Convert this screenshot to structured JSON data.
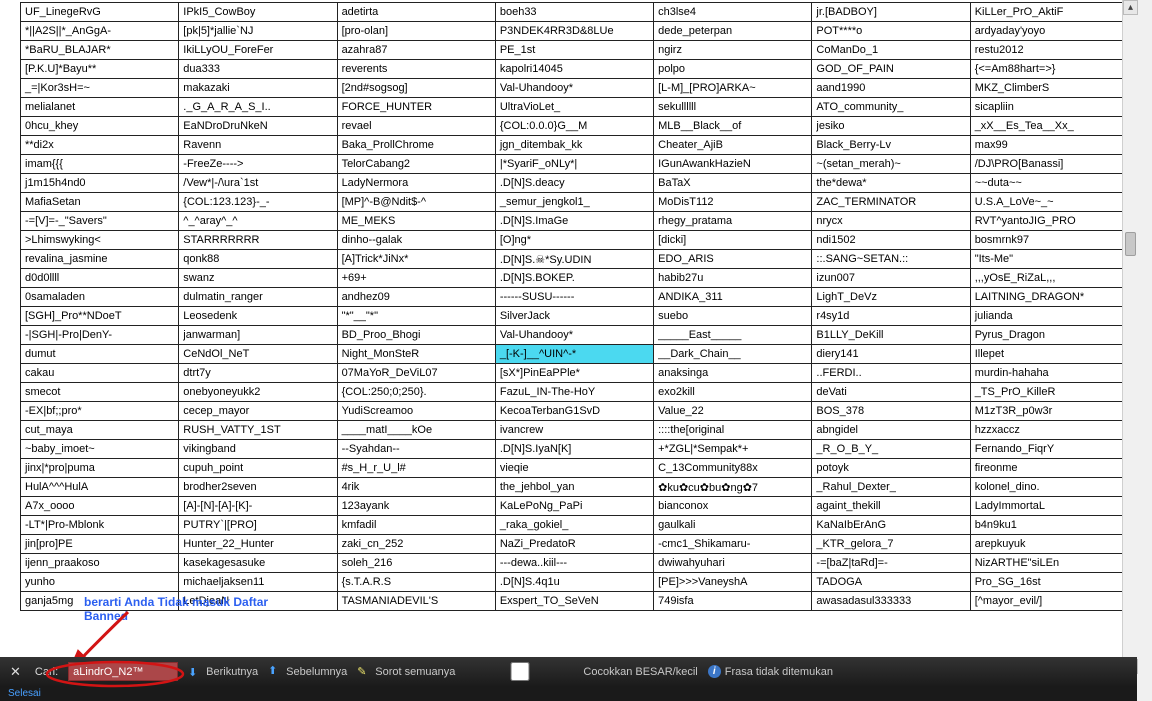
{
  "annotation": {
    "line1": "berarti Anda Tidak masuk Daftar",
    "line2": "Banned"
  },
  "findbar": {
    "label": "Cari:",
    "value": "aLindrO_N2™",
    "next": "Berikutnya",
    "prev": "Sebelumnya",
    "highlight": "Sorot semuanya",
    "matchcase": "Cocokkan BESAR/kecil",
    "notfound": "Frasa tidak ditemukan"
  },
  "statusbar": {
    "text": "Selesai"
  },
  "table": {
    "rows": [
      [
        "UF_LinegeRvG",
        "IPkI5_CowBoy",
        "adetirta",
        "boeh33",
        "ch3lse4",
        "jr.[BADBOY]",
        "KiLLer_PrO_AktiF"
      ],
      [
        "*||A2S||*_AnGgA-",
        "[pk|5]*jallie`NJ",
        "[pro-olan]",
        "P3NDEK4RR3D&8LUe",
        "dede_peterpan",
        "POT****o",
        "ardyaday'yoyo"
      ],
      [
        "*BaRU_BLAJAR*",
        "IkiLLyOU_ForeFer",
        "azahra87",
        "PE_1st",
        "ngirz",
        "CoManDo_1",
        "restu2012"
      ],
      [
        "[P.K.U]*Bayu**",
        "dua333",
        "reverents",
        "kapolri14045",
        "polpo",
        "GOD_OF_PAIN",
        "{<=Am88hart=>}"
      ],
      [
        "_=|Kor3sH=~",
        "makazaki",
        "[2nd#sogsog]",
        "Val-Uhandooy*",
        "[L-M]_[PRO]ARKA~",
        "aand1990",
        "MKZ_ClimberS"
      ],
      [
        "melialanet",
        "._G_A_R_A_S_I..",
        "FORCE_HUNTER",
        "UltraVioLet_",
        "sekullllll",
        "ATO_community_",
        "sicapliin"
      ],
      [
        "0hcu_khey",
        "EaNDroDruNkeN",
        "revael",
        "{COL:0.0.0}G__M",
        "MLB__Black__of",
        "jesiko",
        "_xX__Es_Tea__Xx_"
      ],
      [
        "**di2x",
        "Ravenn",
        "Baka_ProllChrome",
        "jgn_ditembak_kk",
        "Cheater_AjiB",
        "Black_Berry-Lv",
        "max99"
      ],
      [
        "imam{{{",
        "-FreeZe---->",
        "TelorCabang2",
        "|*SyariF_oNLy*|",
        "IGunAwankHazieN",
        "~(setan_merah)~",
        "/DJ\\PRO[Banassi]"
      ],
      [
        "j1m15h4nd0",
        "/Vew*|-/\\ura`1st",
        "LadyNermora",
        ".D[N]S.deacy",
        "BaTaX",
        "the*dewa*",
        "~~duta~~"
      ],
      [
        "MafiaSetan",
        "{COL:123.123}-_-",
        "[MP]^-B@Ndit$-^",
        "_semur_jengkol1_",
        "MoDisT112",
        "ZAC_TERMINATOR",
        "U.S.A_LoVe~_~"
      ],
      [
        "-=[V]=-_\"Savers\"",
        "^_^aray^_^",
        "ME_MEKS",
        ".D[N]S.ImaGe",
        "rhegy_pratama",
        "nrycx",
        "RVT^yantoJIG_PRO"
      ],
      [
        ">Lhimswyking<",
        "STARRRRRRR",
        "dinho--galak",
        "[O]ng*",
        "[dicki]",
        "ndi1502",
        "bosmrnk97"
      ],
      [
        "revalina_jasmine",
        "qonk88",
        "[A]Trick*JiNx*",
        ".D[N]S.☠*Sy.UDIN",
        "EDO_ARIS",
        "::.SANG~SETAN.::",
        "\"Its-Me\""
      ],
      [
        "d0d0llll",
        "swanz",
        "+69+",
        ".D[N]S.BOKEP.",
        "habib27u",
        "izun007",
        ",,,yOsE_RiZaL,,,"
      ],
      [
        "0samaladen",
        "dulmatin_ranger",
        "andhez09",
        "------SUSU------",
        "ANDIKA_311",
        "LighT_DeVz",
        "LAITNING_DRAGON*"
      ],
      [
        "[SGH]_Pro**NDoeT",
        "Leosedenk",
        "\"*\"__\"*\"",
        "SilverJack",
        "suebo",
        "r4sy1d",
        "julianda"
      ],
      [
        "-|SGH|-Pro|DenY-",
        "janwarman]",
        "BD_Proo_Bhogi",
        "Val-Uhandooy*",
        "_____East_____",
        "B1LLY_DeKill",
        "Pyrus_Dragon"
      ],
      [
        "dumut",
        "CeNdOl_NeT",
        "Night_MonSteR",
        "_[-K-]__^UIN^-*",
        "__Dark_Chain__",
        "diery141",
        "Illepet"
      ],
      [
        "cakau",
        "dtrt7y",
        "07MaYoR_DeViL07",
        "[sX*]PinEaPPle*",
        "anaksinga",
        "..FERDI..",
        "murdin-hahaha"
      ],
      [
        "smecot",
        "onebyoneyukk2",
        "{COL:250;0;250}.",
        "FazuL_IN-The-HoY",
        "exo2kill",
        "deVati",
        "_TS_PrO_KilleR"
      ],
      [
        "-EX|bf;;pro*",
        "cecep_mayor",
        "YudiScreamoo",
        "KecoaTerbanG1SvD",
        "Value_22",
        "BOS_378",
        "M1zT3R_p0w3r"
      ],
      [
        "cut_maya",
        "RUSH_VATTY_1ST",
        "____matI____kOe",
        "ivancrew",
        "::::the[original",
        "abngidel",
        "hzzxaccz"
      ],
      [
        "~baby_imoet~",
        "vikingband",
        "--Syahdan--",
        ".D[N]S.IyaN[K]",
        "+*ZGL|*Sempak*+",
        "_R_O_B_Y_",
        "Fernando_FiqrY"
      ],
      [
        "jinx|*pro|puma",
        "cupuh_point",
        "#s_H_r_U_l#",
        "vieqie",
        "C_13Community88x",
        "potoyk",
        "fireonme"
      ],
      [
        "HulA^^^HulA",
        "brodher2seven",
        "4rik",
        "the_jehbol_yan",
        "✿ku✿cu✿bu✿ng✿7",
        "_Rahul_Dexter_",
        "kolonel_dino."
      ],
      [
        "A7x_oooo",
        "[A]-[N]-[A]-[K]-",
        "123ayank",
        "KaLePoNg_PaPi",
        "bianconox",
        "againt_thekill",
        "LadyImmortaL"
      ],
      [
        "-LT*|Pro-Mblonk",
        "PUTRY`|[PRO]",
        "kmfadil",
        "_raka_gokiel_",
        "gaulkali",
        "KaNaIbErAnG",
        "b4n9ku1"
      ],
      [
        "jin[pro]PE",
        "Hunter_22_Hunter",
        "zaki_cn_252",
        "NaZi_PredatoR",
        "-cmc1_Shikamaru-",
        "_KTR_gelora_7",
        "arepkuyuk"
      ],
      [
        "ijenn_praakoso",
        "kasekagesasuke",
        "soleh_216",
        "---dewa..kiil---",
        "dwiwahyuhari",
        "-=[baZ|taRd]=-",
        "NizARTHE\"siLEn"
      ],
      [
        "yunho",
        "michaeljaksen11",
        "{s.T.A.R.S",
        ".D[N]S.4q1u",
        "[PE]>>>VaneyshA",
        "TADOGA",
        "Pro_SG_16st"
      ],
      [
        "ganja5mg",
        "LetDjeaN",
        "TASMANIADEVIL'S",
        "Exspert_TO_SeVeN",
        "749isfa",
        "awasadasul333333",
        "[^mayor_evil/]"
      ]
    ],
    "highlightCell": {
      "row": 18,
      "col": 3
    }
  }
}
